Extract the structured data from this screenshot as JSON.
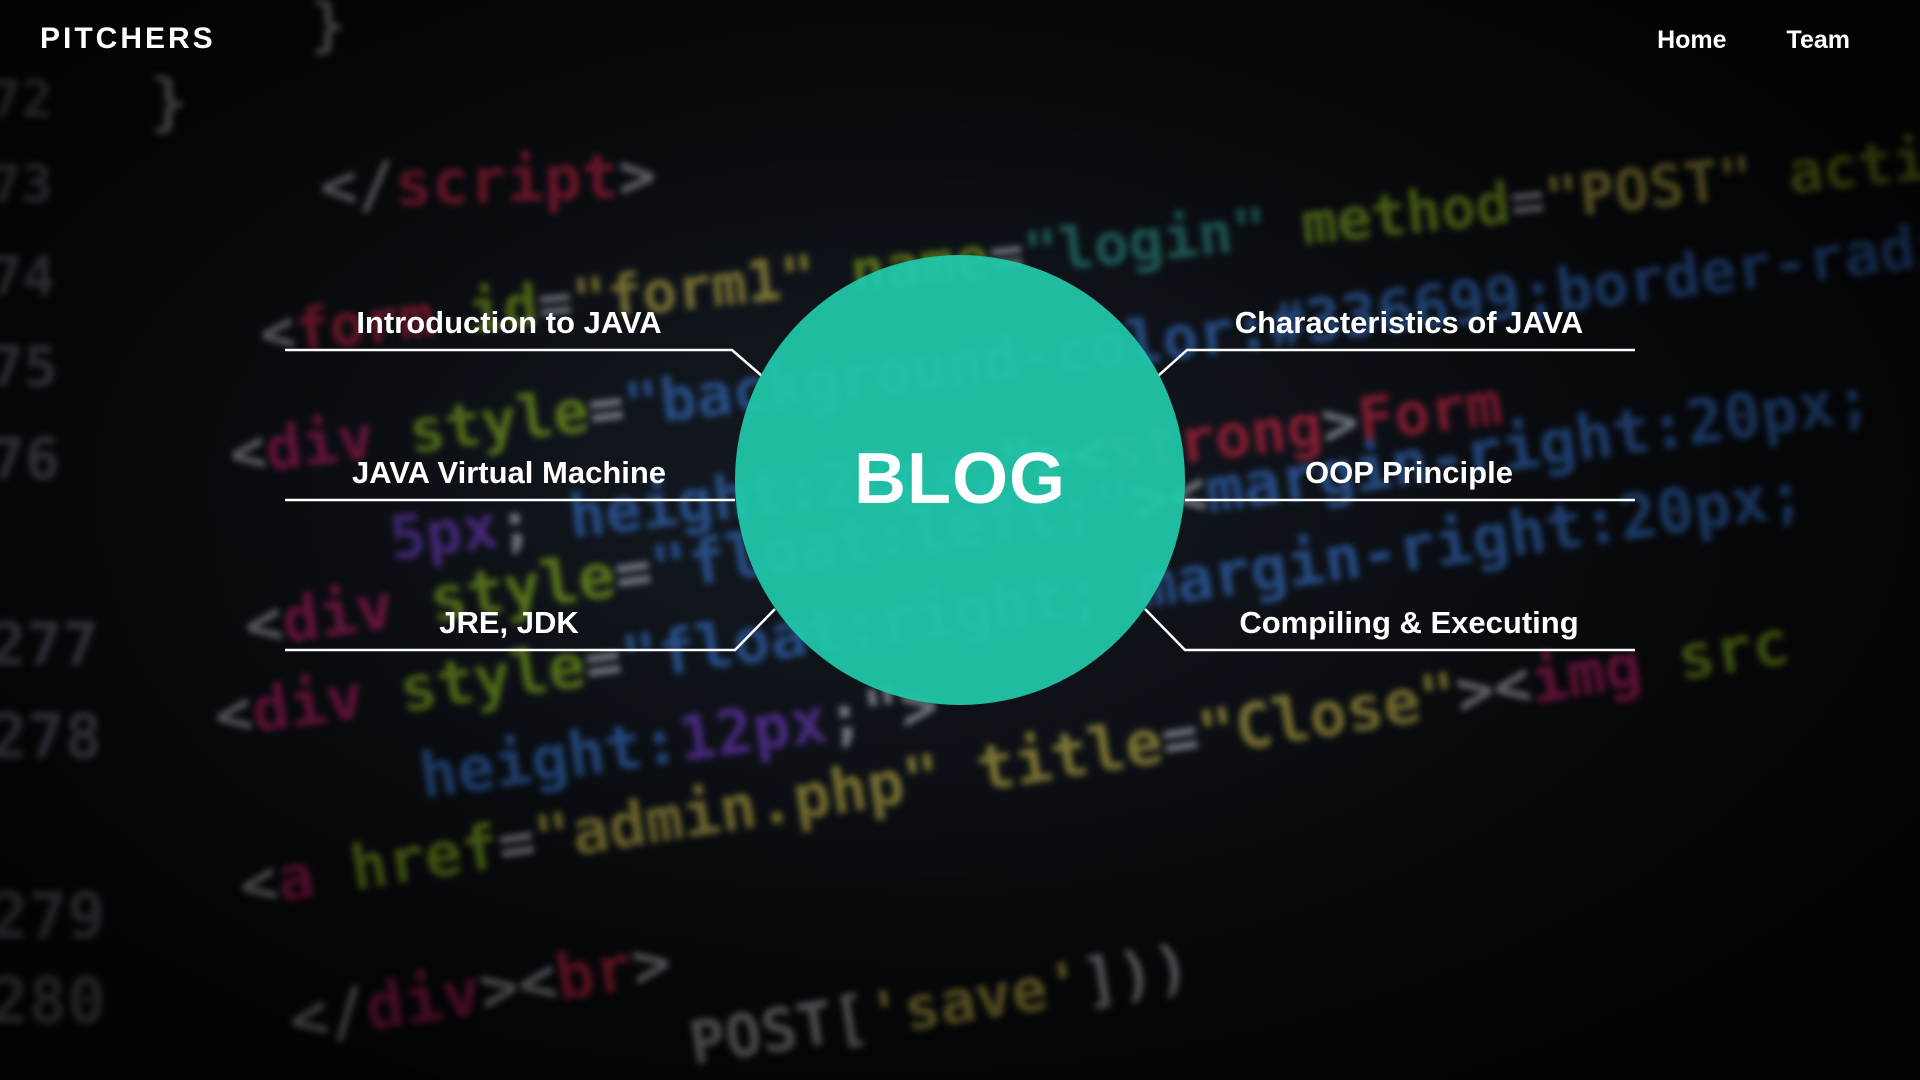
{
  "brand": "PITCHERS",
  "nav": {
    "home": "Home",
    "team": "Team"
  },
  "hero": {
    "title": "BLOG"
  },
  "topics": {
    "left": [
      "Introduction to JAVA",
      "JAVA Virtual Machine",
      "JRE, JDK"
    ],
    "right": [
      "Characteristics of JAVA",
      "OOP Principle",
      "Compiling & Executing"
    ]
  },
  "colors": {
    "accent": "#20c9ab",
    "text": "#ffffff",
    "background": "#050608"
  }
}
